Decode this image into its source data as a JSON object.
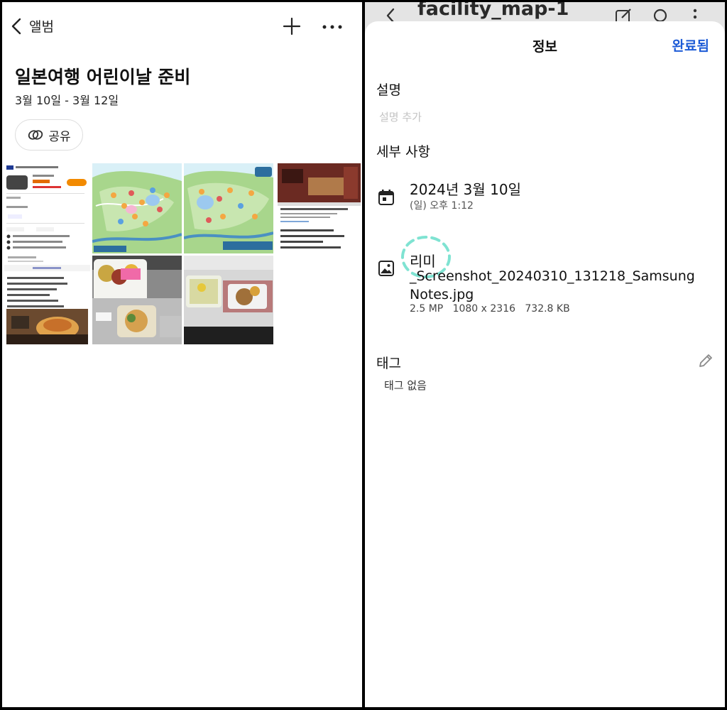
{
  "left": {
    "back_label": "앨범",
    "album_title": "일본여행 어린이날 준비",
    "album_date": "3월 10일 - 3월 12일",
    "share_label": "공유",
    "icons": [
      "chevron-left-icon",
      "plus-icon",
      "more-icon",
      "share-link-icon"
    ],
    "thumbnails": [
      "rental-car-screenshot-thumbnail",
      "park-map-thumbnail",
      "park-map-2-thumbnail",
      "restaurant-screenshot-thumbnail",
      "airline-meal-thumbnail",
      "sandwich-meal-thumbnail"
    ]
  },
  "right": {
    "background_app_title": "facility_map-1",
    "background_icons": [
      "back-icon",
      "edit-icon",
      "search-icon",
      "more-icon"
    ],
    "sheet_title": "정보",
    "done_label": "완료됨",
    "description_label": "설명",
    "description_placeholder": "설명 추가",
    "details_label": "세부 사항",
    "date": {
      "icon": "calendar-icon",
      "main": "2024년 3월 10일",
      "sub": "(일) 오후 1:12"
    },
    "image": {
      "icon": "image-icon",
      "album": "리미",
      "filename": "_Screenshot_20240310_131218_Samsung Notes.jpg",
      "meta": "2.5 MP   1080 x 2316   732.8 KB"
    },
    "tags_label": "태그",
    "tags_value": "태그 없음",
    "tag_edit_icon": "pencil-icon"
  },
  "colors": {
    "accent": "#1d5bd6",
    "placeholder": "#c4c4c4",
    "dashed_ring": "#7fe3d2"
  }
}
